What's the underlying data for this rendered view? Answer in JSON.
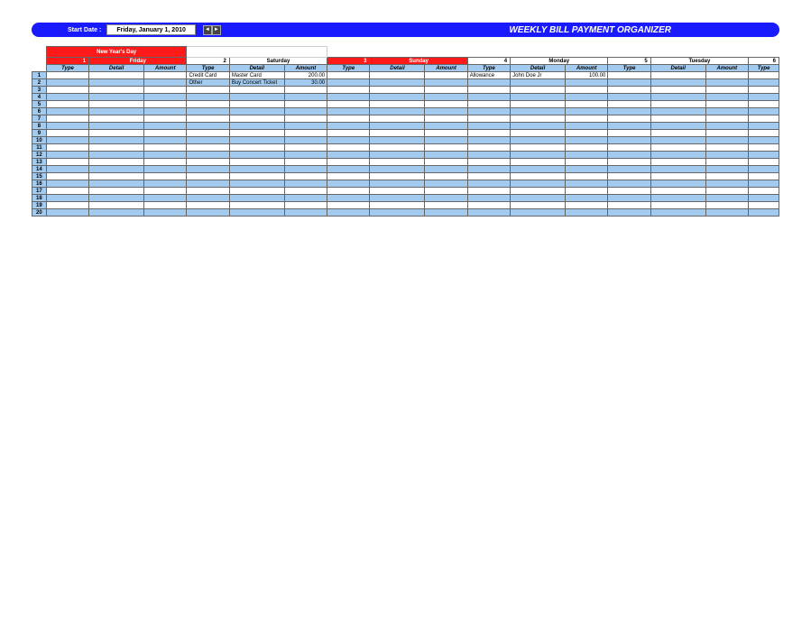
{
  "header": {
    "start_label": "Start Date :",
    "date_value": "Friday, January 1, 2010",
    "title": "WEEKLY BILL PAYMENT ORGANIZER"
  },
  "holiday": "New Year's Day",
  "days": [
    {
      "num": "1",
      "name": "Friday",
      "highlight": true
    },
    {
      "num": "2",
      "name": "Saturday",
      "highlight": false
    },
    {
      "num": "3",
      "name": "Sunday",
      "highlight": true
    },
    {
      "num": "4",
      "name": "Monday",
      "highlight": false
    },
    {
      "num": "5",
      "name": "Tuesday",
      "highlight": false
    },
    {
      "num": "6",
      "name": "",
      "highlight": false
    }
  ],
  "column_labels": {
    "type": "Type",
    "detail": "Detail",
    "amount": "Amount"
  },
  "rows": [
    {
      "n": "1",
      "d": [
        {
          "t": "",
          "d": "",
          "a": ""
        },
        {
          "t": "Credit Card",
          "d": "Master Card",
          "a": "200.00"
        },
        {
          "t": "",
          "d": "",
          "a": ""
        },
        {
          "t": "Allowance",
          "d": "John Doe Jr",
          "a": "100.00"
        },
        {
          "t": "",
          "d": "",
          "a": ""
        }
      ],
      "last": ""
    },
    {
      "n": "2",
      "d": [
        {
          "t": "",
          "d": "",
          "a": ""
        },
        {
          "t": "Other",
          "d": "Buy Concert Ticket",
          "a": "30.00"
        },
        {
          "t": "",
          "d": "",
          "a": ""
        },
        {
          "t": "",
          "d": "",
          "a": ""
        },
        {
          "t": "",
          "d": "",
          "a": ""
        }
      ],
      "last": ""
    },
    {
      "n": "3",
      "d": [
        {
          "t": "",
          "d": "",
          "a": ""
        },
        {
          "t": "",
          "d": "",
          "a": ""
        },
        {
          "t": "",
          "d": "",
          "a": ""
        },
        {
          "t": "",
          "d": "",
          "a": ""
        },
        {
          "t": "",
          "d": "",
          "a": ""
        }
      ],
      "last": ""
    },
    {
      "n": "4",
      "d": [
        {
          "t": "",
          "d": "",
          "a": ""
        },
        {
          "t": "",
          "d": "",
          "a": ""
        },
        {
          "t": "",
          "d": "",
          "a": ""
        },
        {
          "t": "",
          "d": "",
          "a": ""
        },
        {
          "t": "",
          "d": "",
          "a": ""
        }
      ],
      "last": ""
    },
    {
      "n": "5",
      "d": [
        {
          "t": "",
          "d": "",
          "a": ""
        },
        {
          "t": "",
          "d": "",
          "a": ""
        },
        {
          "t": "",
          "d": "",
          "a": ""
        },
        {
          "t": "",
          "d": "",
          "a": ""
        },
        {
          "t": "",
          "d": "",
          "a": ""
        }
      ],
      "last": ""
    },
    {
      "n": "6",
      "d": [
        {
          "t": "",
          "d": "",
          "a": ""
        },
        {
          "t": "",
          "d": "",
          "a": ""
        },
        {
          "t": "",
          "d": "",
          "a": ""
        },
        {
          "t": "",
          "d": "",
          "a": ""
        },
        {
          "t": "",
          "d": "",
          "a": ""
        }
      ],
      "last": ""
    },
    {
      "n": "7",
      "d": [
        {
          "t": "",
          "d": "",
          "a": ""
        },
        {
          "t": "",
          "d": "",
          "a": ""
        },
        {
          "t": "",
          "d": "",
          "a": ""
        },
        {
          "t": "",
          "d": "",
          "a": ""
        },
        {
          "t": "",
          "d": "",
          "a": ""
        }
      ],
      "last": ""
    },
    {
      "n": "8",
      "d": [
        {
          "t": "",
          "d": "",
          "a": ""
        },
        {
          "t": "",
          "d": "",
          "a": ""
        },
        {
          "t": "",
          "d": "",
          "a": ""
        },
        {
          "t": "",
          "d": "",
          "a": ""
        },
        {
          "t": "",
          "d": "",
          "a": ""
        }
      ],
      "last": ""
    },
    {
      "n": "9",
      "d": [
        {
          "t": "",
          "d": "",
          "a": ""
        },
        {
          "t": "",
          "d": "",
          "a": ""
        },
        {
          "t": "",
          "d": "",
          "a": ""
        },
        {
          "t": "",
          "d": "",
          "a": ""
        },
        {
          "t": "",
          "d": "",
          "a": ""
        }
      ],
      "last": ""
    },
    {
      "n": "10",
      "d": [
        {
          "t": "",
          "d": "",
          "a": ""
        },
        {
          "t": "",
          "d": "",
          "a": ""
        },
        {
          "t": "",
          "d": "",
          "a": ""
        },
        {
          "t": "",
          "d": "",
          "a": ""
        },
        {
          "t": "",
          "d": "",
          "a": ""
        }
      ],
      "last": ""
    },
    {
      "n": "11",
      "d": [
        {
          "t": "",
          "d": "",
          "a": ""
        },
        {
          "t": "",
          "d": "",
          "a": ""
        },
        {
          "t": "",
          "d": "",
          "a": ""
        },
        {
          "t": "",
          "d": "",
          "a": ""
        },
        {
          "t": "",
          "d": "",
          "a": ""
        }
      ],
      "last": ""
    },
    {
      "n": "12",
      "d": [
        {
          "t": "",
          "d": "",
          "a": ""
        },
        {
          "t": "",
          "d": "",
          "a": ""
        },
        {
          "t": "",
          "d": "",
          "a": ""
        },
        {
          "t": "",
          "d": "",
          "a": ""
        },
        {
          "t": "",
          "d": "",
          "a": ""
        }
      ],
      "last": ""
    },
    {
      "n": "13",
      "d": [
        {
          "t": "",
          "d": "",
          "a": ""
        },
        {
          "t": "",
          "d": "",
          "a": ""
        },
        {
          "t": "",
          "d": "",
          "a": ""
        },
        {
          "t": "",
          "d": "",
          "a": ""
        },
        {
          "t": "",
          "d": "",
          "a": ""
        }
      ],
      "last": ""
    },
    {
      "n": "14",
      "d": [
        {
          "t": "",
          "d": "",
          "a": ""
        },
        {
          "t": "",
          "d": "",
          "a": ""
        },
        {
          "t": "",
          "d": "",
          "a": ""
        },
        {
          "t": "",
          "d": "",
          "a": ""
        },
        {
          "t": "",
          "d": "",
          "a": ""
        }
      ],
      "last": ""
    },
    {
      "n": "15",
      "d": [
        {
          "t": "",
          "d": "",
          "a": ""
        },
        {
          "t": "",
          "d": "",
          "a": ""
        },
        {
          "t": "",
          "d": "",
          "a": ""
        },
        {
          "t": "",
          "d": "",
          "a": ""
        },
        {
          "t": "",
          "d": "",
          "a": ""
        }
      ],
      "last": ""
    },
    {
      "n": "16",
      "d": [
        {
          "t": "",
          "d": "",
          "a": ""
        },
        {
          "t": "",
          "d": "",
          "a": ""
        },
        {
          "t": "",
          "d": "",
          "a": ""
        },
        {
          "t": "",
          "d": "",
          "a": ""
        },
        {
          "t": "",
          "d": "",
          "a": ""
        }
      ],
      "last": ""
    },
    {
      "n": "17",
      "d": [
        {
          "t": "",
          "d": "",
          "a": ""
        },
        {
          "t": "",
          "d": "",
          "a": ""
        },
        {
          "t": "",
          "d": "",
          "a": ""
        },
        {
          "t": "",
          "d": "",
          "a": ""
        },
        {
          "t": "",
          "d": "",
          "a": ""
        }
      ],
      "last": ""
    },
    {
      "n": "18",
      "d": [
        {
          "t": "",
          "d": "",
          "a": ""
        },
        {
          "t": "",
          "d": "",
          "a": ""
        },
        {
          "t": "",
          "d": "",
          "a": ""
        },
        {
          "t": "",
          "d": "",
          "a": ""
        },
        {
          "t": "",
          "d": "",
          "a": ""
        }
      ],
      "last": ""
    },
    {
      "n": "19",
      "d": [
        {
          "t": "",
          "d": "",
          "a": ""
        },
        {
          "t": "",
          "d": "",
          "a": ""
        },
        {
          "t": "",
          "d": "",
          "a": ""
        },
        {
          "t": "",
          "d": "",
          "a": ""
        },
        {
          "t": "",
          "d": "",
          "a": ""
        }
      ],
      "last": ""
    },
    {
      "n": "20",
      "d": [
        {
          "t": "",
          "d": "",
          "a": ""
        },
        {
          "t": "",
          "d": "",
          "a": ""
        },
        {
          "t": "",
          "d": "",
          "a": ""
        },
        {
          "t": "",
          "d": "",
          "a": ""
        },
        {
          "t": "",
          "d": "",
          "a": ""
        }
      ],
      "last": ""
    }
  ]
}
